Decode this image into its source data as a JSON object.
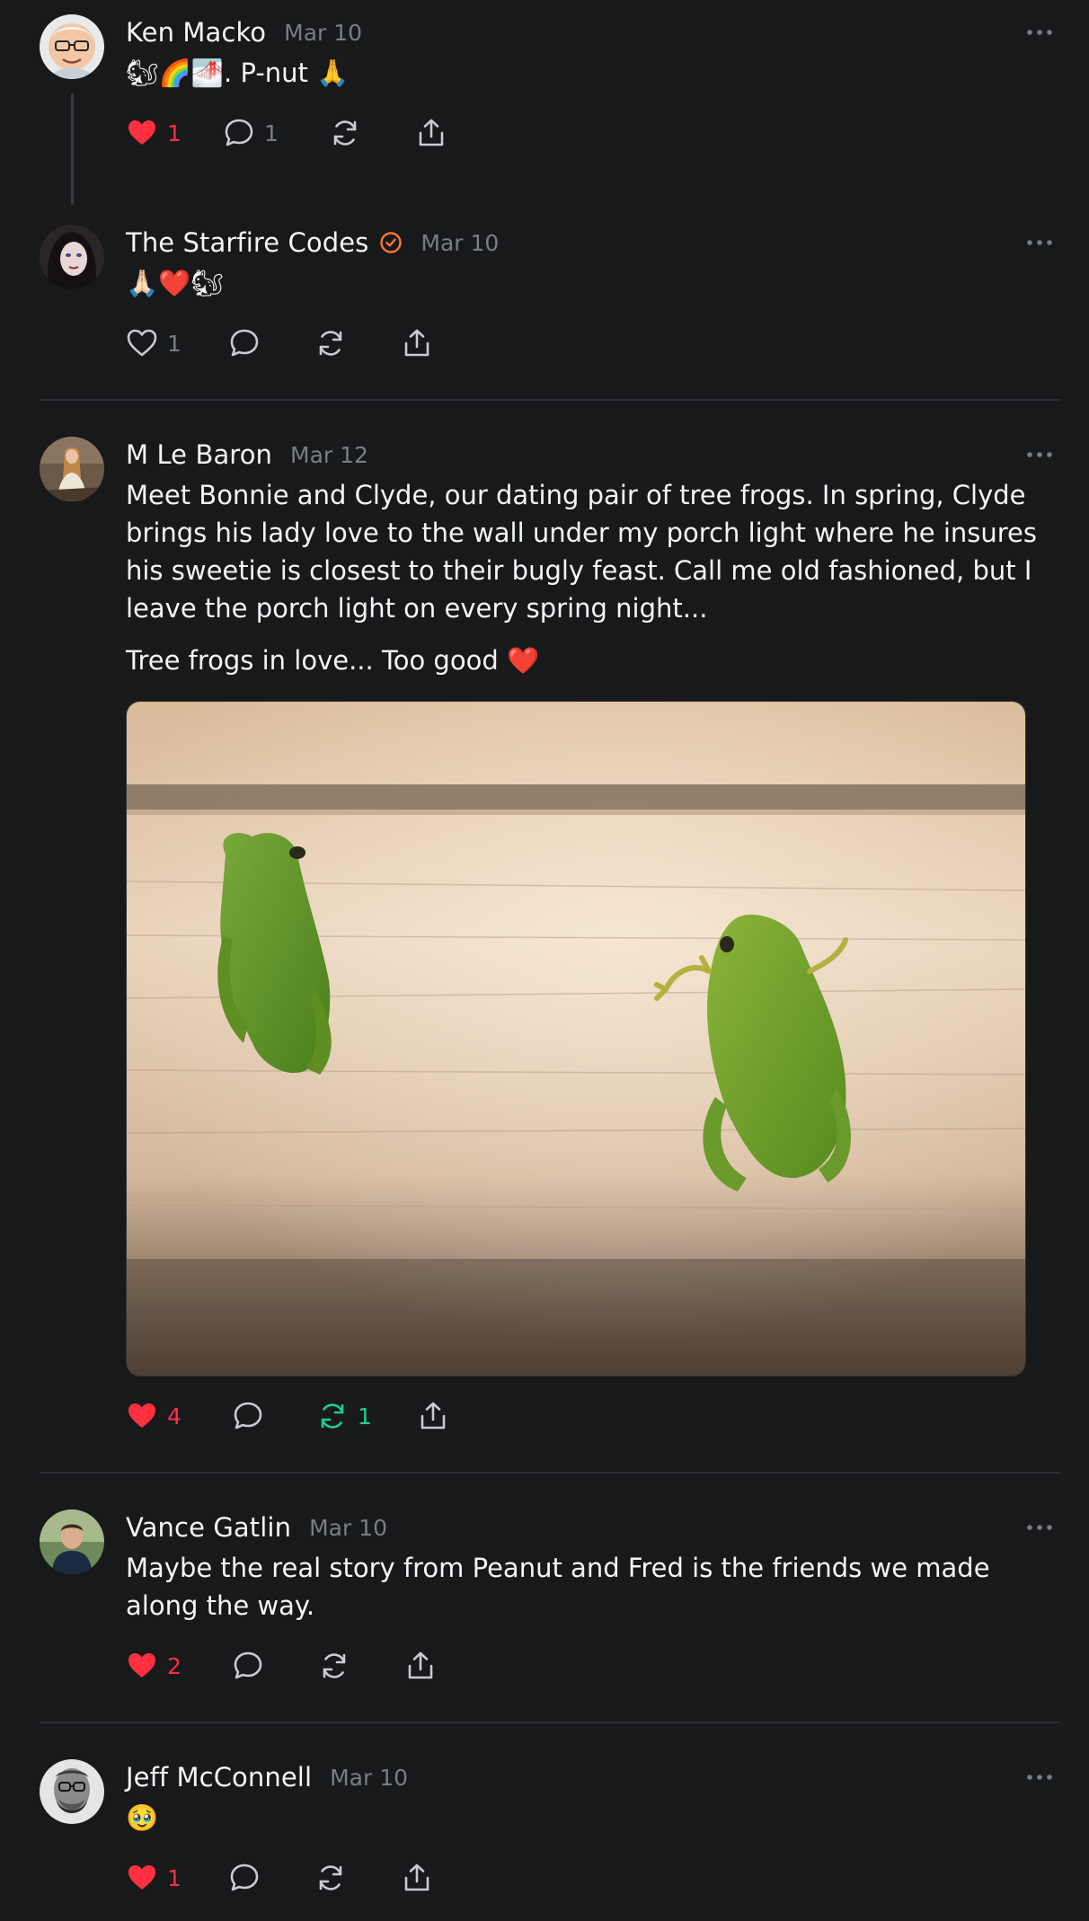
{
  "posts": [
    {
      "author": "Ken Macko",
      "date": "Mar 10",
      "text": "🐿🌈🌁. P-nut 🙏",
      "likes": "1",
      "replies": "1",
      "liked": true
    },
    {
      "author": "The Starfire Codes",
      "date": "Mar 10",
      "text": "🙏🏻❤️🐿",
      "likes": "1",
      "verified": true
    },
    {
      "author": "M Le Baron",
      "date": "Mar 12",
      "text": "Meet Bonnie and Clyde, our dating pair of tree frogs. In spring, Clyde brings his lady love to the wall under my porch light where he insures his sweetie is closest to their bugly feast. Call me old fashioned, but I leave the porch light on every spring night...",
      "text2": "Tree frogs in love... Too good ❤️",
      "likes": "4",
      "reposts": "1",
      "liked": true,
      "reposted": true
    },
    {
      "author": "Vance Gatlin",
      "date": "Mar 10",
      "text": "Maybe the real story from Peanut and Fred is the friends we made along the way.",
      "likes": "2",
      "liked": true
    },
    {
      "author": "Jeff McConnell",
      "date": "Mar 10",
      "text": "🥹",
      "likes": "1",
      "liked": true
    }
  ],
  "colors": {
    "background": "#18191b",
    "like_red": "#ff3040",
    "repost_green": "#1fcf8b",
    "verified_orange": "#ff7a2f",
    "muted": "#7a7d82"
  },
  "icons": [
    "heart-icon",
    "comment-icon",
    "repost-icon",
    "share-icon",
    "more-icon",
    "verified-icon"
  ]
}
